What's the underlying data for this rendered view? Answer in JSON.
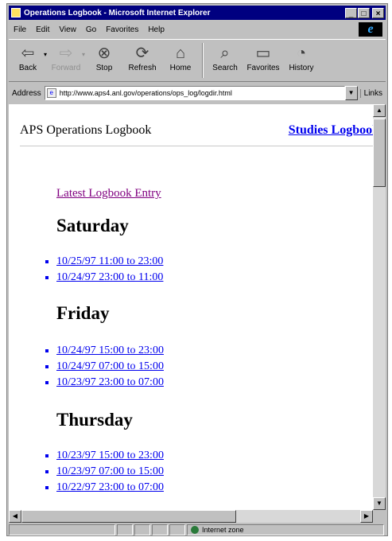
{
  "window": {
    "title": "Operations Logbook - Microsoft Internet Explorer"
  },
  "menu": [
    "File",
    "Edit",
    "View",
    "Go",
    "Favorites",
    "Help"
  ],
  "toolbar": [
    {
      "label": "Back",
      "icon": "back-arrow-icon",
      "glyph": "⇦",
      "enabled": true
    },
    {
      "label": "Forward",
      "icon": "forward-arrow-icon",
      "glyph": "⇨",
      "enabled": false
    },
    {
      "label": "Stop",
      "icon": "stop-icon",
      "glyph": "⊗",
      "enabled": true
    },
    {
      "label": "Refresh",
      "icon": "refresh-icon",
      "glyph": "⟳",
      "enabled": true
    },
    {
      "label": "Home",
      "icon": "home-icon",
      "glyph": "⌂",
      "enabled": true
    },
    {
      "label": "Search",
      "icon": "search-icon",
      "glyph": "⌕",
      "enabled": true
    },
    {
      "label": "Favorites",
      "icon": "favorites-icon",
      "glyph": "▭",
      "enabled": true
    },
    {
      "label": "History",
      "icon": "history-icon",
      "glyph": "◔",
      "enabled": true
    }
  ],
  "address": {
    "label": "Address",
    "url": "http://www.aps4.anl.gov/operations/ops_log/logdir.html",
    "links_label": "Links"
  },
  "page": {
    "title": "APS Operations Logbook",
    "studies_link": "Studies Logbook",
    "latest_link": "Latest Logbook Entry",
    "days": [
      {
        "name": "Saturday",
        "entries": [
          "10/25/97 11:00 to 23:00",
          "10/24/97 23:00 to 11:00"
        ]
      },
      {
        "name": "Friday",
        "entries": [
          "10/24/97 15:00 to 23:00",
          "10/24/97 07:00 to 15:00",
          "10/23/97 23:00 to 07:00"
        ]
      },
      {
        "name": "Thursday",
        "entries": [
          "10/23/97 15:00 to 23:00",
          "10/23/97 07:00 to 15:00",
          "10/22/97 23:00 to 07:00"
        ]
      }
    ]
  },
  "status": {
    "zone": "Internet zone"
  },
  "colors": {
    "titlebar": "#000080",
    "link": "#0000ee",
    "visited_link": "#800080"
  }
}
